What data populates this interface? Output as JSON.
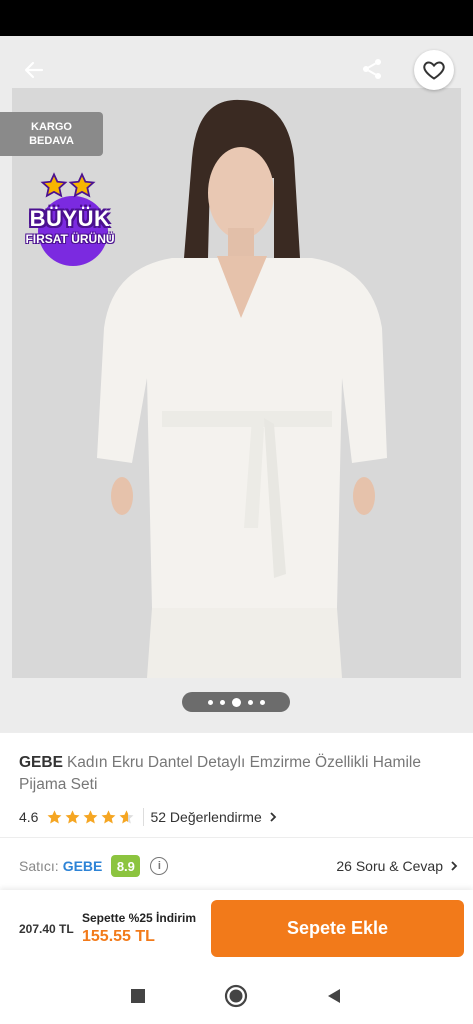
{
  "badges": {
    "kargo_line1": "KARGO",
    "kargo_line2": "BEDAVA",
    "buyuk_line1": "BÜYÜK",
    "buyuk_line2": "FIRSAT ÜRÜNÜ"
  },
  "gallery": {
    "image_count": 5,
    "active_index": 2
  },
  "product": {
    "brand": "GEBE",
    "name": "Kadın Ekru Dantel Detaylı Emzirme Özellikli Hamile Pijama Seti",
    "rating": "4.6",
    "rating_value": 4.6,
    "reviews_label": "52 Değerlendirme"
  },
  "seller": {
    "label": "Satıcı:",
    "name": "GEBE",
    "score": "8.9",
    "qa_label": "26 Soru & Cevap"
  },
  "purchase": {
    "old_price": "207.40 TL",
    "promo_label": "Sepette %25 İndirim",
    "promo_price": "155.55 TL",
    "add_to_cart": "Sepete Ekle"
  },
  "colors": {
    "accent": "#f27a1a",
    "seller_link": "#2d83d6",
    "score_bg": "#8cc43f",
    "star": "#f5a623",
    "badge_purple": "#7b2ae0"
  },
  "icons": [
    "back-arrow-icon",
    "share-icon",
    "heart-icon",
    "star-icon",
    "chevron-right-icon",
    "info-icon",
    "nav-square-icon",
    "nav-circle-icon",
    "nav-triangle-icon"
  ]
}
